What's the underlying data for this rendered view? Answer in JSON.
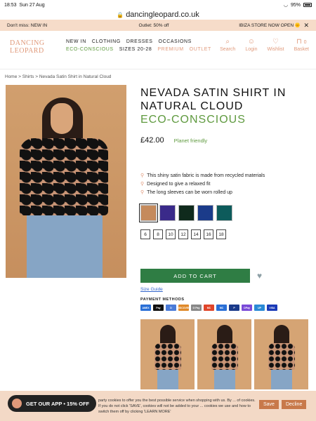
{
  "statusbar": {
    "time": "18:53",
    "date": "Sun 27 Aug",
    "battery": "95%"
  },
  "url": "dancingleopard.co.uk",
  "promo": {
    "left": "Don't miss: NEW IN",
    "center": "Outlet: 50% off",
    "right": "IBIZA STORE NOW OPEN 🌞"
  },
  "logo": {
    "line1": "DANCING",
    "line2": "LEOPARD"
  },
  "nav": [
    {
      "label": "NEW IN",
      "tone": "dark"
    },
    {
      "label": "CLOTHING",
      "tone": "dark"
    },
    {
      "label": "DRESSES",
      "tone": "dark"
    },
    {
      "label": "OCCASIONS",
      "tone": "dark"
    },
    {
      "label": "ECO-CONSCIOUS",
      "tone": "green"
    },
    {
      "label": "SIZES 20-28",
      "tone": "dark"
    },
    {
      "label": "PREMIUM",
      "tone": "pink"
    },
    {
      "label": "OUTLET",
      "tone": "pink"
    }
  ],
  "header_icons": {
    "search": "Search",
    "login": "Login",
    "wishlist": "Wishlist",
    "basket": "Basket",
    "basket_count": "0"
  },
  "breadcrumb": {
    "home": "Home",
    "shirts": "Shirts",
    "current": "Nevada Satin Shirt in Natural Cloud"
  },
  "product": {
    "title": "NEVADA SATIN SHIRT IN NATURAL CLOUD",
    "eco": "ECO-CONSCIOUS",
    "price": "£42.00",
    "badge": "Planet friendly",
    "bullets": [
      "This shiny satin fabric is made from recycled materials",
      "Designed to give a relaxed fit",
      "The long sleeves can be worn rolled up"
    ],
    "swatch_colors": [
      "#c58a5c",
      "#3a2a8a",
      "#0f2a1c",
      "#1b3b8a",
      "#0d5b5b"
    ],
    "sizes": [
      "6",
      "8",
      "10",
      "12",
      "14",
      "16",
      "18"
    ],
    "add_to_cart": "ADD TO CART",
    "size_guide": "Size Guide",
    "payment_label": "PAYMENT METHODS",
    "payments": [
      {
        "name": "AMEX",
        "color": "#2a6fd6"
      },
      {
        "name": "Pay",
        "color": "#111111"
      },
      {
        "name": "D",
        "color": "#4a7bd8"
      },
      {
        "name": "DISCOVER",
        "color": "#e08a2a"
      },
      {
        "name": "G Pay",
        "color": "#888888"
      },
      {
        "name": "MC",
        "color": "#e0452a"
      },
      {
        "name": "MC",
        "color": "#2a6fd6"
      },
      {
        "name": "P",
        "color": "#1a3a8a"
      },
      {
        "name": "OPay",
        "color": "#7a4ad8"
      },
      {
        "name": "UP",
        "color": "#2a8ad6"
      },
      {
        "name": "VISA",
        "color": "#1a3ab8"
      }
    ]
  },
  "cookie": {
    "text": "party cookies to offer you the best possible service when shopping with us. By ... of cookies. If you do not click 'SAVE', cookies will not be added to your ... cookies we use and how to switch them off by clicking 'LEARN MORE'",
    "save": "Save",
    "decline": "Decline"
  },
  "app_promo": "GET OUR APP • 15% OFF"
}
